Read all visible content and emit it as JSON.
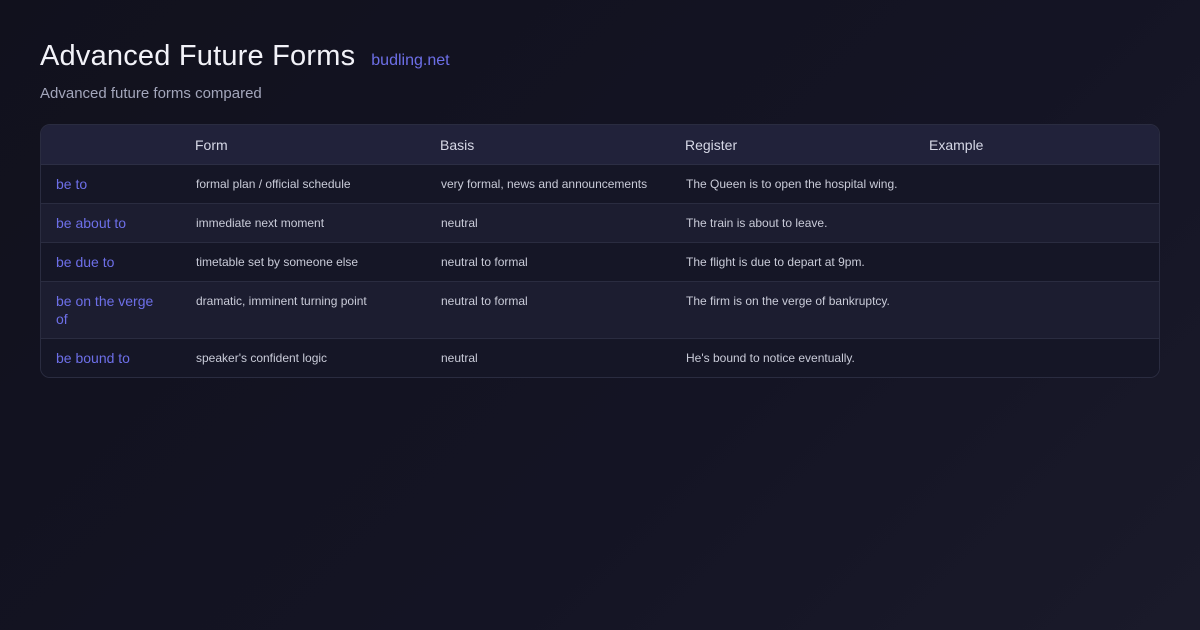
{
  "header": {
    "title": "Advanced Future Forms",
    "site": "budling.net",
    "subtitle": "Advanced future forms compared"
  },
  "table": {
    "columns": [
      "",
      "Form",
      "Basis",
      "Register",
      "Example"
    ],
    "rows": [
      {
        "term": "be to",
        "form": "formal plan / official schedule",
        "basis": "very formal, news and announcements",
        "register": "The Queen is to open the hospital wing.",
        "example": ""
      },
      {
        "term": "be about to",
        "form": "immediate next moment",
        "basis": "neutral",
        "register": "The train is about to leave.",
        "example": ""
      },
      {
        "term": "be due to",
        "form": "timetable set by someone else",
        "basis": "neutral to formal",
        "register": "The flight is due to depart at 9pm.",
        "example": ""
      },
      {
        "term": "be on the verge of",
        "form": "dramatic, imminent turning point",
        "basis": "neutral to formal",
        "register": "The firm is on the verge of bankruptcy.",
        "example": ""
      },
      {
        "term": "be bound to",
        "form": "speaker's confident logic",
        "basis": "neutral",
        "register": "He's bound to notice eventually.",
        "example": ""
      }
    ]
  }
}
